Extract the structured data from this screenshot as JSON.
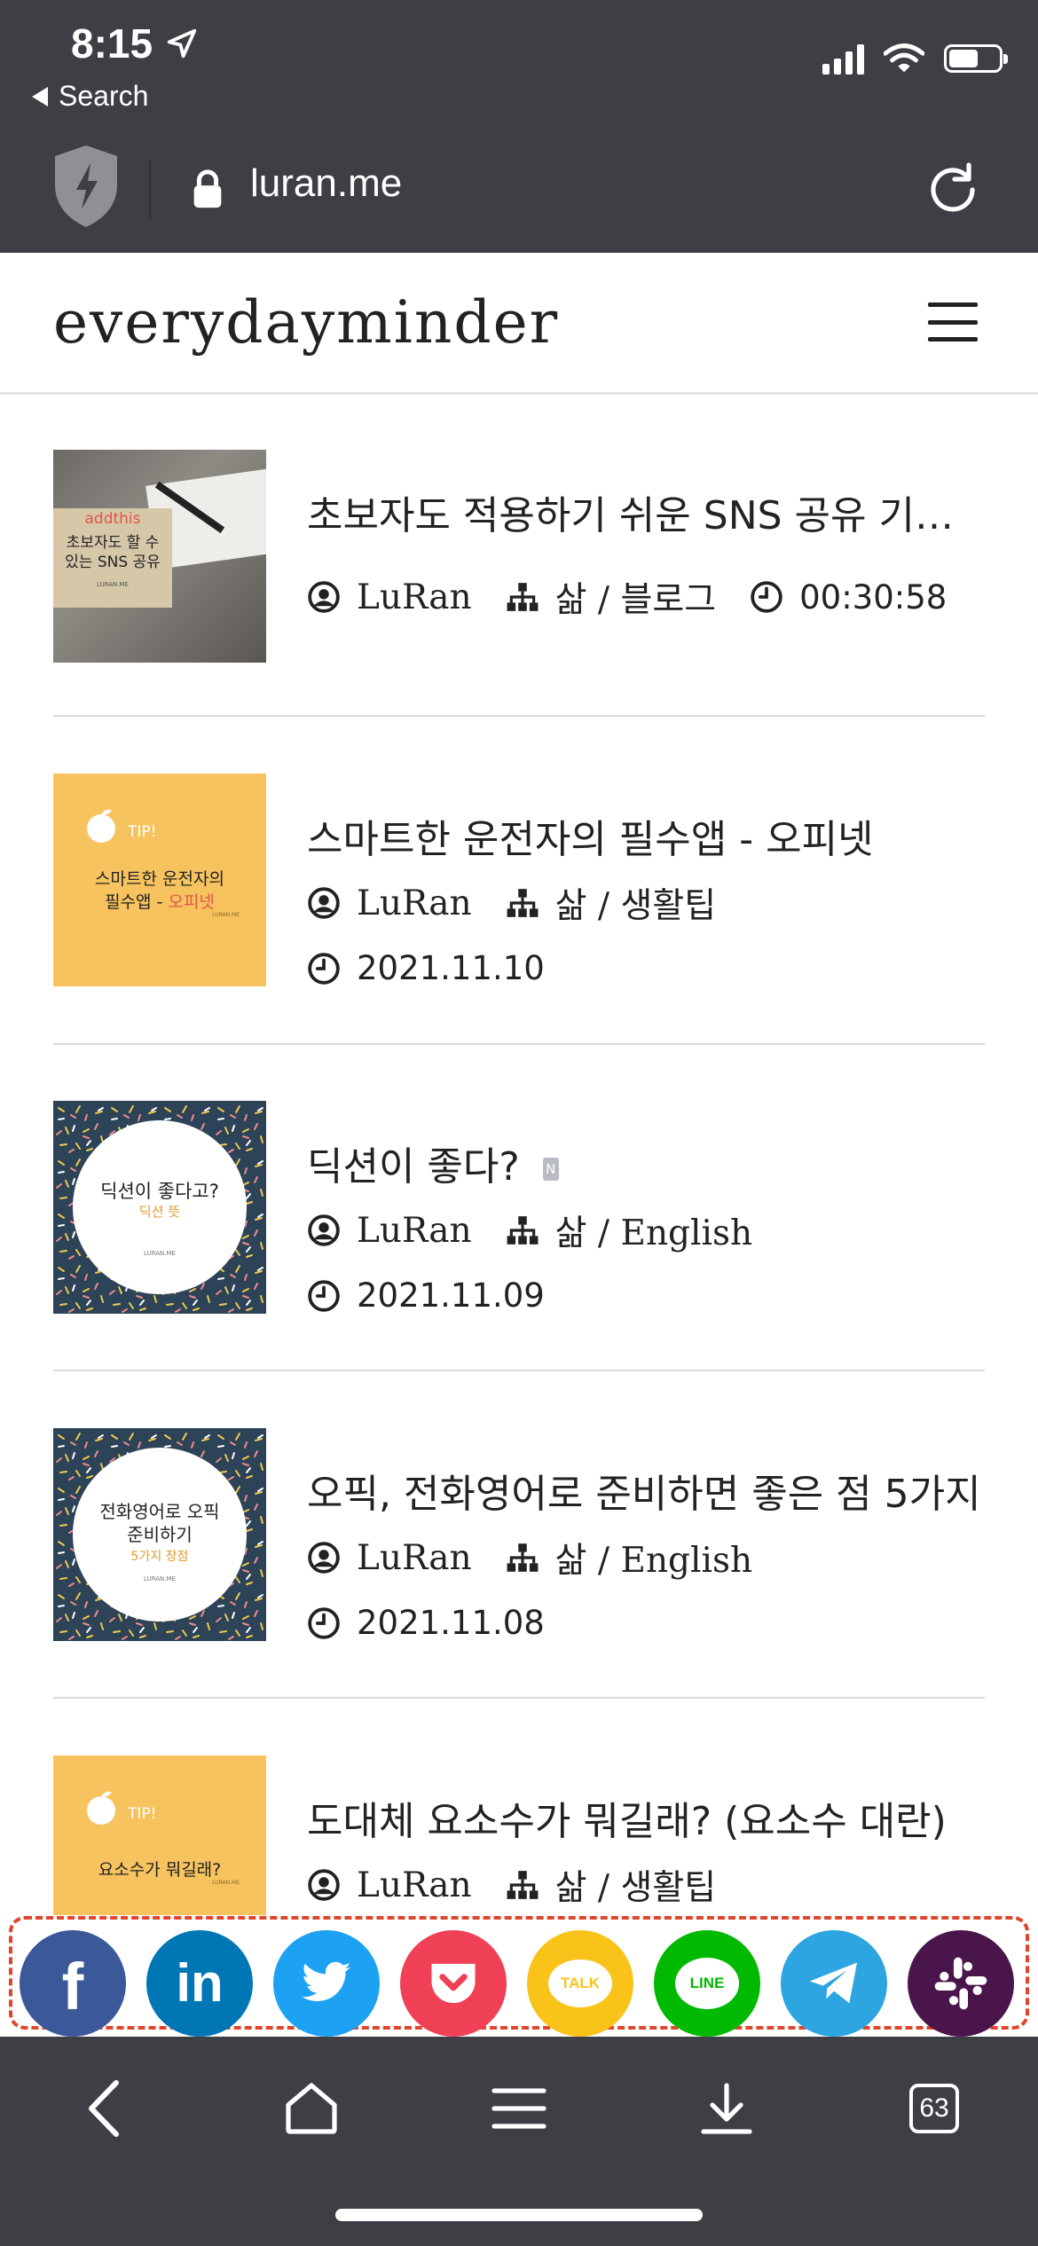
{
  "status": {
    "time": "8:15",
    "back_label": "Search"
  },
  "browser": {
    "url": "luran.me",
    "tab_count": "63"
  },
  "site": {
    "title": "everydayminder"
  },
  "posts": [
    {
      "title": "초보자도 적용하기 쉬운 SNS 공유 기능 - AddThis",
      "author": "LuRan",
      "category": "삶 / 블로그",
      "time": "00:30:58",
      "thumb": {
        "brand": "addthis",
        "line1": "초보자도 할 수",
        "line2": "있는 SNS 공유",
        "credit": "LURAN.ME"
      }
    },
    {
      "title": "스마트한 운전자의 필수앱 - 오피넷",
      "author": "LuRan",
      "category": "삶 / 생활팁",
      "time": "2021.11.10",
      "thumb": {
        "tip": "TIP!",
        "line1": "스마트한 운전자의",
        "line2a": "필수앱 - ",
        "line2b": "오피넷",
        "credit": "LURAN.ME"
      }
    },
    {
      "title": "딕션이 좋다?",
      "author": "LuRan",
      "category": "삶 / English",
      "time": "2021.11.09",
      "badge": "N",
      "thumb": {
        "line1": "딕션이 좋다고?",
        "line2": "딕션 뜻",
        "credit": "LURAN.ME"
      }
    },
    {
      "title": "오픽, 전화영어로 준비하면 좋은 점 5가지",
      "author": "LuRan",
      "category": "삶 / English",
      "time": "2021.11.08",
      "thumb": {
        "line1": "전화영어로 오픽",
        "line2": "준비하기",
        "line3": "5가지 장점",
        "credit": "LURAN.ME"
      }
    },
    {
      "title": "도대체 요소수가 뭐길래? (요소수 대란)",
      "author": "LuRan",
      "category": "삶 / 생활팁",
      "thumb": {
        "tip": "TIP!",
        "line1": "요소수가 뭐길래?",
        "credit": "LURAN.ME"
      }
    }
  ],
  "share": [
    {
      "name": "facebook",
      "label": "f",
      "color": "#3b5998"
    },
    {
      "name": "linkedin",
      "label": "in",
      "color": "#0077b5"
    },
    {
      "name": "twitter",
      "color": "#1da1f2"
    },
    {
      "name": "pocket",
      "color": "#ef4056"
    },
    {
      "name": "kakaotalk",
      "label": "TALK",
      "color": "#f9c31a"
    },
    {
      "name": "line",
      "label": "LINE",
      "color": "#00b900"
    },
    {
      "name": "telegram",
      "color": "#2ca5e0"
    },
    {
      "name": "slack",
      "color": "#4a154b"
    }
  ]
}
